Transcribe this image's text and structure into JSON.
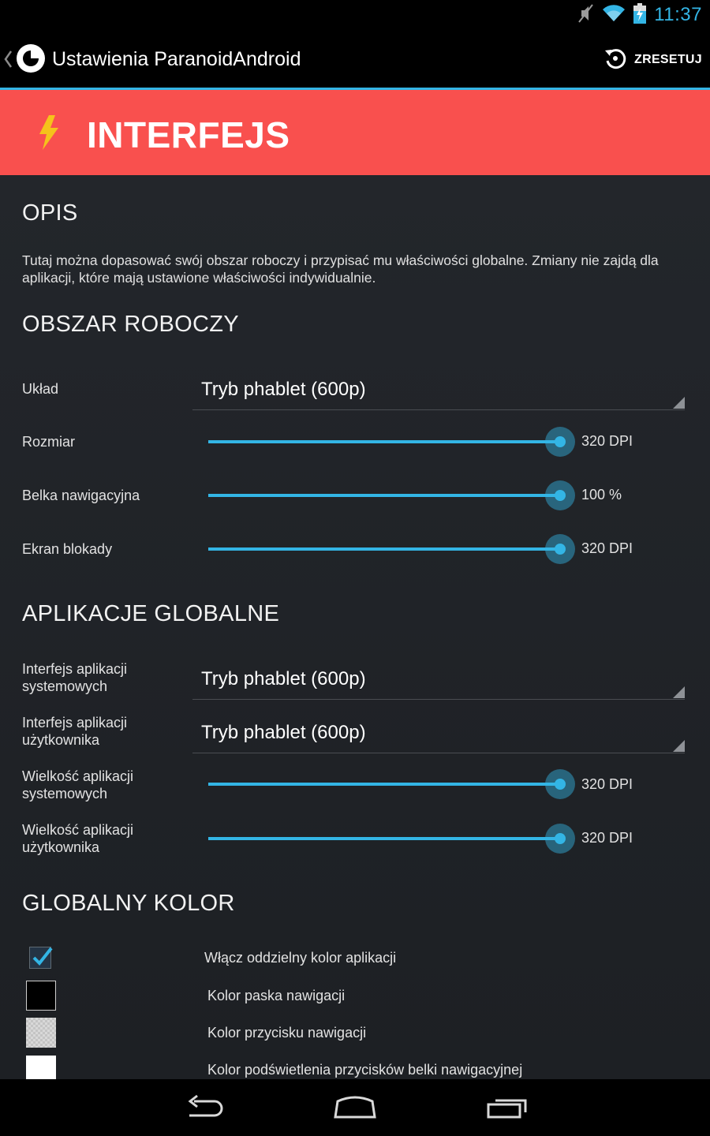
{
  "status_bar": {
    "time": "11:37"
  },
  "action_bar": {
    "title": "Ustawienia ParanoidAndroid",
    "reset_label": "ZRESETUJ"
  },
  "banner": {
    "title": "INTERFEJS"
  },
  "opis": {
    "heading": "OPIS",
    "text": "Tutaj można dopasować swój obszar roboczy i przypisać mu właściwości globalne. Zmiany nie zajdą dla aplikacji, które mają ustawione właściwości indywidualnie."
  },
  "obszar": {
    "heading": "OBSZAR ROBOCZY",
    "uklad": {
      "label": "Układ",
      "value": "Tryb phablet (600p)"
    },
    "rozmiar": {
      "label": "Rozmiar",
      "value": "320 DPI",
      "fraction": 1.0
    },
    "belka": {
      "label": "Belka nawigacyjna",
      "value": "100 %",
      "fraction": 1.0
    },
    "ekran": {
      "label": "Ekran blokady",
      "value": "320 DPI",
      "fraction": 1.0
    }
  },
  "aplikacje": {
    "heading": "APLIKACJE GLOBALNE",
    "sys_ui": {
      "label1": "Interfejs aplikacji",
      "label2": "systemowych",
      "value": "Tryb phablet (600p)"
    },
    "user_ui": {
      "label1": "Interfejs aplikacji",
      "label2": "użytkownika",
      "value": "Tryb phablet (600p)"
    },
    "sys_size": {
      "label1": "Wielkość aplikacji",
      "label2": "systemowych",
      "value": "320 DPI",
      "fraction": 1.0
    },
    "user_size": {
      "label1": "Wielkość aplikacji",
      "label2": "użytkownika",
      "value": "320 DPI",
      "fraction": 1.0
    }
  },
  "kolor": {
    "heading": "GLOBALNY KOLOR",
    "enable": {
      "label": "Włącz oddzielny kolor aplikacji",
      "checked": true
    },
    "navbar_color": {
      "label": "Kolor paska nawigacji",
      "color": "#000000"
    },
    "navbtn_color": {
      "label": "Kolor przycisku nawigacji",
      "color": "#d8d8d8"
    },
    "glow_color": {
      "label": "Kolor podświetlenia przycisków belki nawigacyjnej",
      "color": "#ffffff"
    }
  },
  "colors": {
    "accent": "#33b5e5",
    "banner": "#f9504e"
  },
  "icons": [
    "muted-icon",
    "wifi-icon",
    "battery-charging-icon",
    "paranoid-logo-icon",
    "reset-icon",
    "lightning-bolt-icon",
    "back-nav-icon",
    "home-nav-icon",
    "recents-nav-icon"
  ]
}
